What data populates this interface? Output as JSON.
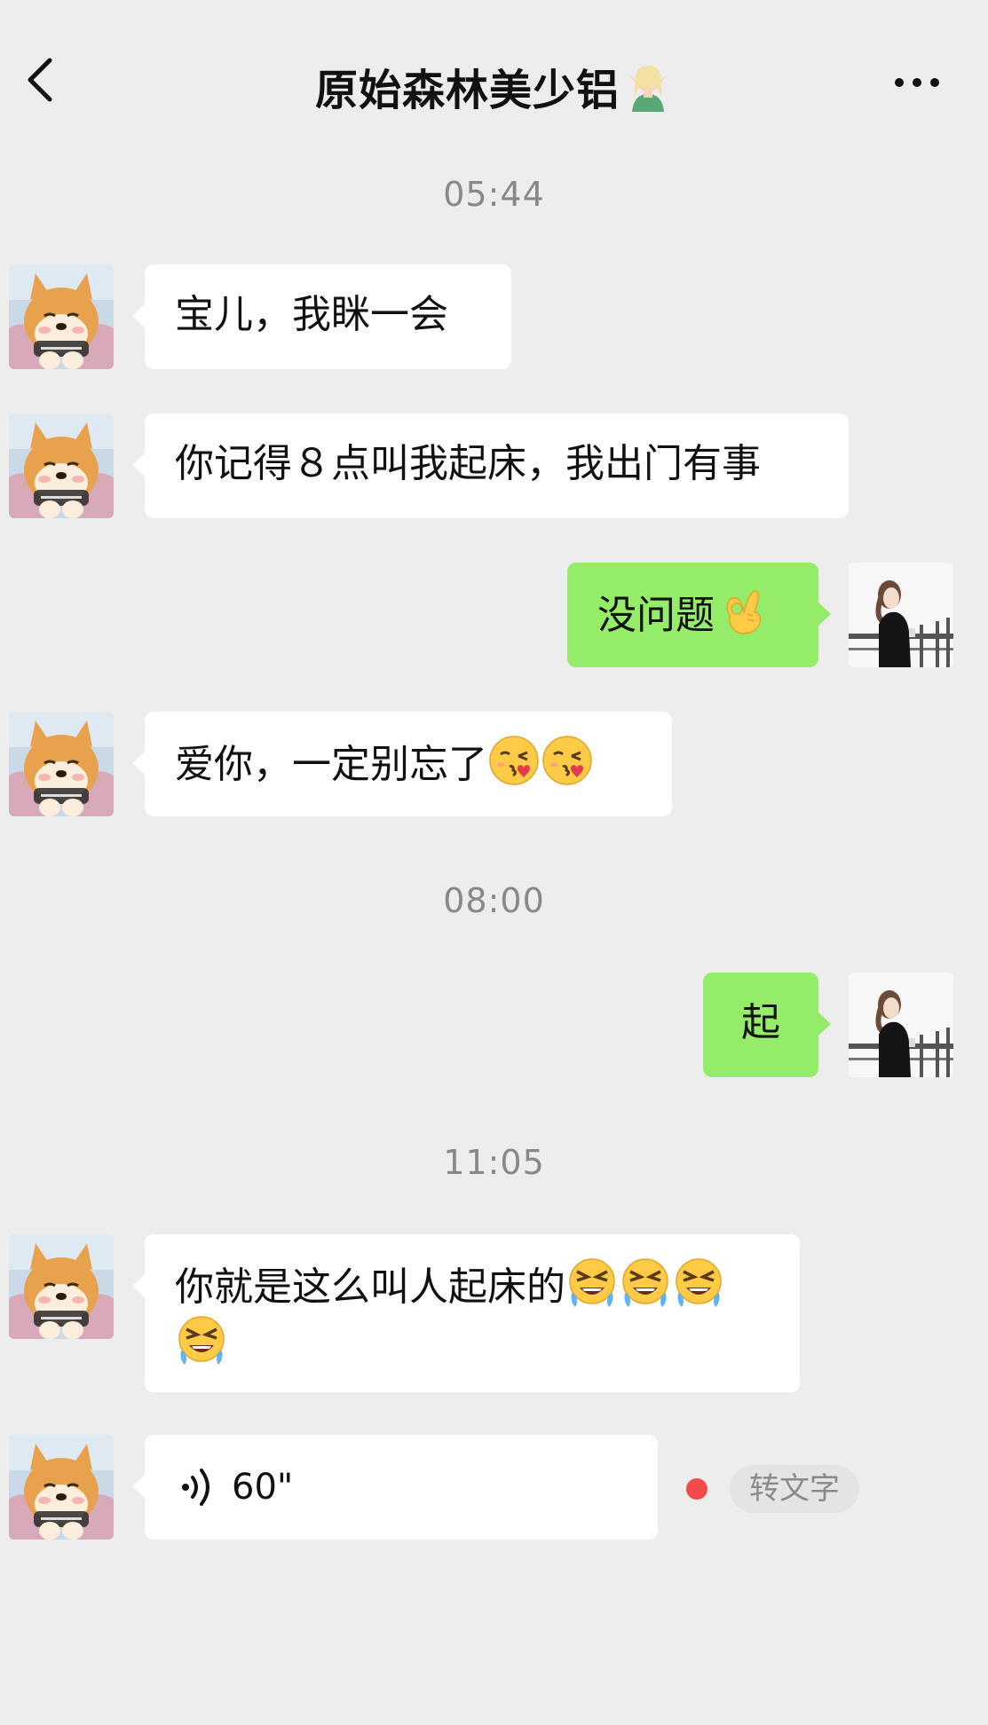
{
  "header": {
    "title": "原始森林美少铝",
    "title_emoji": "elf-woman-emoji",
    "back_icon": "chevron-left-icon",
    "more_icon": "more-dots-icon"
  },
  "contact_avatar": "shiba-dog-avatar",
  "self_avatar": "woman-railing-avatar",
  "colors": {
    "background": "#ededed",
    "self_bubble": "#95ec69",
    "other_bubble": "#ffffff",
    "timestamp": "#888888",
    "unread_dot": "#f14b4b"
  },
  "messages": [
    {
      "time": "05:44"
    },
    {
      "from": "contact",
      "text": "宝儿，我眯一会"
    },
    {
      "from": "contact",
      "text": "你记得８点叫我起床，我出门有事"
    },
    {
      "from": "self",
      "text": "没问题",
      "emoji": [
        "ok-hand-emoji"
      ]
    },
    {
      "from": "contact",
      "text": "爱你，一定别忘了",
      "emoji": [
        "kissing-heart-emoji",
        "kissing-heart-emoji"
      ]
    },
    {
      "time": "08:00"
    },
    {
      "from": "self",
      "text": "起"
    },
    {
      "time": "11:05"
    },
    {
      "from": "contact",
      "text": "你就是这么叫人起床的",
      "emoji": [
        "angry-tears-emoji",
        "angry-tears-emoji",
        "angry-tears-emoji",
        "angry-tears-emoji"
      ]
    },
    {
      "from": "contact",
      "type": "voice",
      "duration": "60\"",
      "transcribe_label": "转文字",
      "unread": true
    }
  ],
  "time1": "05:44",
  "time2": "08:00",
  "time3": "11:05",
  "msg1": "宝儿，我眯一会",
  "msg2": "你记得８点叫我起床，我出门有事",
  "msg3": "没问题",
  "msg4": "爱你，一定别忘了",
  "msg5": "起",
  "msg6": "你就是这么叫人起床的",
  "voice_duration": "60\"",
  "transcribe_label": "转文字"
}
